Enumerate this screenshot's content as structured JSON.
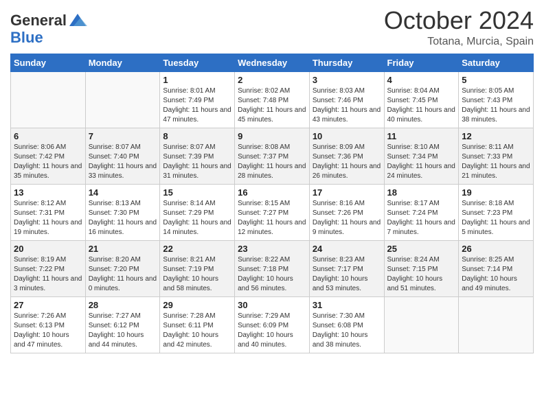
{
  "header": {
    "logo_general": "General",
    "logo_blue": "Blue",
    "month": "October 2024",
    "location": "Totana, Murcia, Spain"
  },
  "days_of_week": [
    "Sunday",
    "Monday",
    "Tuesday",
    "Wednesday",
    "Thursday",
    "Friday",
    "Saturday"
  ],
  "weeks": [
    [
      {
        "day": "",
        "info": ""
      },
      {
        "day": "",
        "info": ""
      },
      {
        "day": "1",
        "info": "Sunrise: 8:01 AM\nSunset: 7:49 PM\nDaylight: 11 hours and 47 minutes."
      },
      {
        "day": "2",
        "info": "Sunrise: 8:02 AM\nSunset: 7:48 PM\nDaylight: 11 hours and 45 minutes."
      },
      {
        "day": "3",
        "info": "Sunrise: 8:03 AM\nSunset: 7:46 PM\nDaylight: 11 hours and 43 minutes."
      },
      {
        "day": "4",
        "info": "Sunrise: 8:04 AM\nSunset: 7:45 PM\nDaylight: 11 hours and 40 minutes."
      },
      {
        "day": "5",
        "info": "Sunrise: 8:05 AM\nSunset: 7:43 PM\nDaylight: 11 hours and 38 minutes."
      }
    ],
    [
      {
        "day": "6",
        "info": "Sunrise: 8:06 AM\nSunset: 7:42 PM\nDaylight: 11 hours and 35 minutes."
      },
      {
        "day": "7",
        "info": "Sunrise: 8:07 AM\nSunset: 7:40 PM\nDaylight: 11 hours and 33 minutes."
      },
      {
        "day": "8",
        "info": "Sunrise: 8:07 AM\nSunset: 7:39 PM\nDaylight: 11 hours and 31 minutes."
      },
      {
        "day": "9",
        "info": "Sunrise: 8:08 AM\nSunset: 7:37 PM\nDaylight: 11 hours and 28 minutes."
      },
      {
        "day": "10",
        "info": "Sunrise: 8:09 AM\nSunset: 7:36 PM\nDaylight: 11 hours and 26 minutes."
      },
      {
        "day": "11",
        "info": "Sunrise: 8:10 AM\nSunset: 7:34 PM\nDaylight: 11 hours and 24 minutes."
      },
      {
        "day": "12",
        "info": "Sunrise: 8:11 AM\nSunset: 7:33 PM\nDaylight: 11 hours and 21 minutes."
      }
    ],
    [
      {
        "day": "13",
        "info": "Sunrise: 8:12 AM\nSunset: 7:31 PM\nDaylight: 11 hours and 19 minutes."
      },
      {
        "day": "14",
        "info": "Sunrise: 8:13 AM\nSunset: 7:30 PM\nDaylight: 11 hours and 16 minutes."
      },
      {
        "day": "15",
        "info": "Sunrise: 8:14 AM\nSunset: 7:29 PM\nDaylight: 11 hours and 14 minutes."
      },
      {
        "day": "16",
        "info": "Sunrise: 8:15 AM\nSunset: 7:27 PM\nDaylight: 11 hours and 12 minutes."
      },
      {
        "day": "17",
        "info": "Sunrise: 8:16 AM\nSunset: 7:26 PM\nDaylight: 11 hours and 9 minutes."
      },
      {
        "day": "18",
        "info": "Sunrise: 8:17 AM\nSunset: 7:24 PM\nDaylight: 11 hours and 7 minutes."
      },
      {
        "day": "19",
        "info": "Sunrise: 8:18 AM\nSunset: 7:23 PM\nDaylight: 11 hours and 5 minutes."
      }
    ],
    [
      {
        "day": "20",
        "info": "Sunrise: 8:19 AM\nSunset: 7:22 PM\nDaylight: 11 hours and 3 minutes."
      },
      {
        "day": "21",
        "info": "Sunrise: 8:20 AM\nSunset: 7:20 PM\nDaylight: 11 hours and 0 minutes."
      },
      {
        "day": "22",
        "info": "Sunrise: 8:21 AM\nSunset: 7:19 PM\nDaylight: 10 hours and 58 minutes."
      },
      {
        "day": "23",
        "info": "Sunrise: 8:22 AM\nSunset: 7:18 PM\nDaylight: 10 hours and 56 minutes."
      },
      {
        "day": "24",
        "info": "Sunrise: 8:23 AM\nSunset: 7:17 PM\nDaylight: 10 hours and 53 minutes."
      },
      {
        "day": "25",
        "info": "Sunrise: 8:24 AM\nSunset: 7:15 PM\nDaylight: 10 hours and 51 minutes."
      },
      {
        "day": "26",
        "info": "Sunrise: 8:25 AM\nSunset: 7:14 PM\nDaylight: 10 hours and 49 minutes."
      }
    ],
    [
      {
        "day": "27",
        "info": "Sunrise: 7:26 AM\nSunset: 6:13 PM\nDaylight: 10 hours and 47 minutes."
      },
      {
        "day": "28",
        "info": "Sunrise: 7:27 AM\nSunset: 6:12 PM\nDaylight: 10 hours and 44 minutes."
      },
      {
        "day": "29",
        "info": "Sunrise: 7:28 AM\nSunset: 6:11 PM\nDaylight: 10 hours and 42 minutes."
      },
      {
        "day": "30",
        "info": "Sunrise: 7:29 AM\nSunset: 6:09 PM\nDaylight: 10 hours and 40 minutes."
      },
      {
        "day": "31",
        "info": "Sunrise: 7:30 AM\nSunset: 6:08 PM\nDaylight: 10 hours and 38 minutes."
      },
      {
        "day": "",
        "info": ""
      },
      {
        "day": "",
        "info": ""
      }
    ]
  ]
}
